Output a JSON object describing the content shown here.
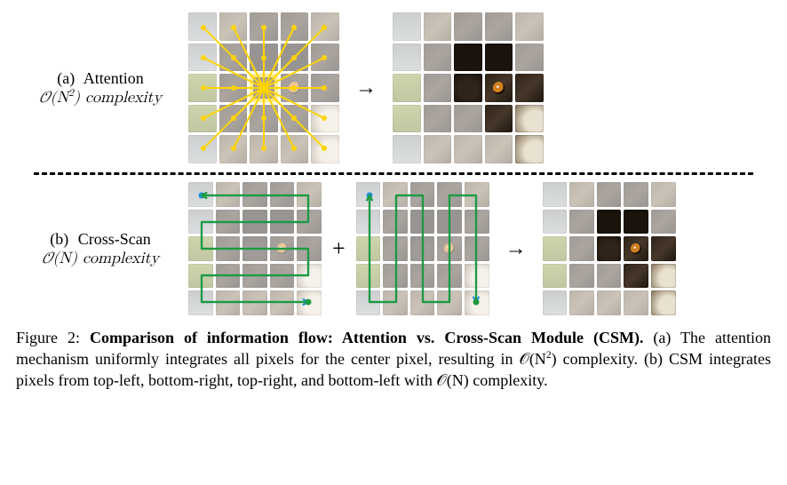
{
  "row_a": {
    "tag": "(a)",
    "title": "Attention",
    "complexity_html": "𝒪(N<span class=\"sup\">2</span>) complexity",
    "arrow": "→"
  },
  "row_b": {
    "tag": "(b)",
    "title": "Cross-Scan",
    "complexity_html": "𝒪(N) complexity",
    "plus": "+",
    "arrow": "→"
  },
  "caption": {
    "label": "Figure 2:",
    "title": "Comparison of information flow: Attention vs. Cross-Scan Module (CSM).",
    "body_a": " (a) The attention mechanism uniformly integrates all pixels for the center pixel, resulting in 𝒪(N",
    "body_a_sup": "2",
    "body_a_tail": ") complexity. (b) CSM integrates pixels from top-left, bottom-right, top-right, and bottom-left with 𝒪(N) complexity."
  },
  "grid": {
    "cols": 5,
    "rows": 5,
    "classes": [
      "blur",
      "fur-lt",
      "fur",
      "fur",
      "fur-lt",
      "blur",
      "fur",
      "dark",
      "dark",
      "fur",
      "grass",
      "fur",
      "nose",
      "fur eye",
      "fur",
      "grass",
      "fur",
      "fur",
      "fur",
      "tusk",
      "blur",
      "fur-lt",
      "fur-lt",
      "fur-lt",
      "tusk"
    ],
    "clear_idx": [
      7,
      8,
      12,
      13,
      14,
      18,
      19,
      24
    ],
    "center_idx": 12
  },
  "colors": {
    "attention": "#ffd400",
    "scan_blue": "#1e90d8",
    "scan_green": "#1d9b3e"
  }
}
